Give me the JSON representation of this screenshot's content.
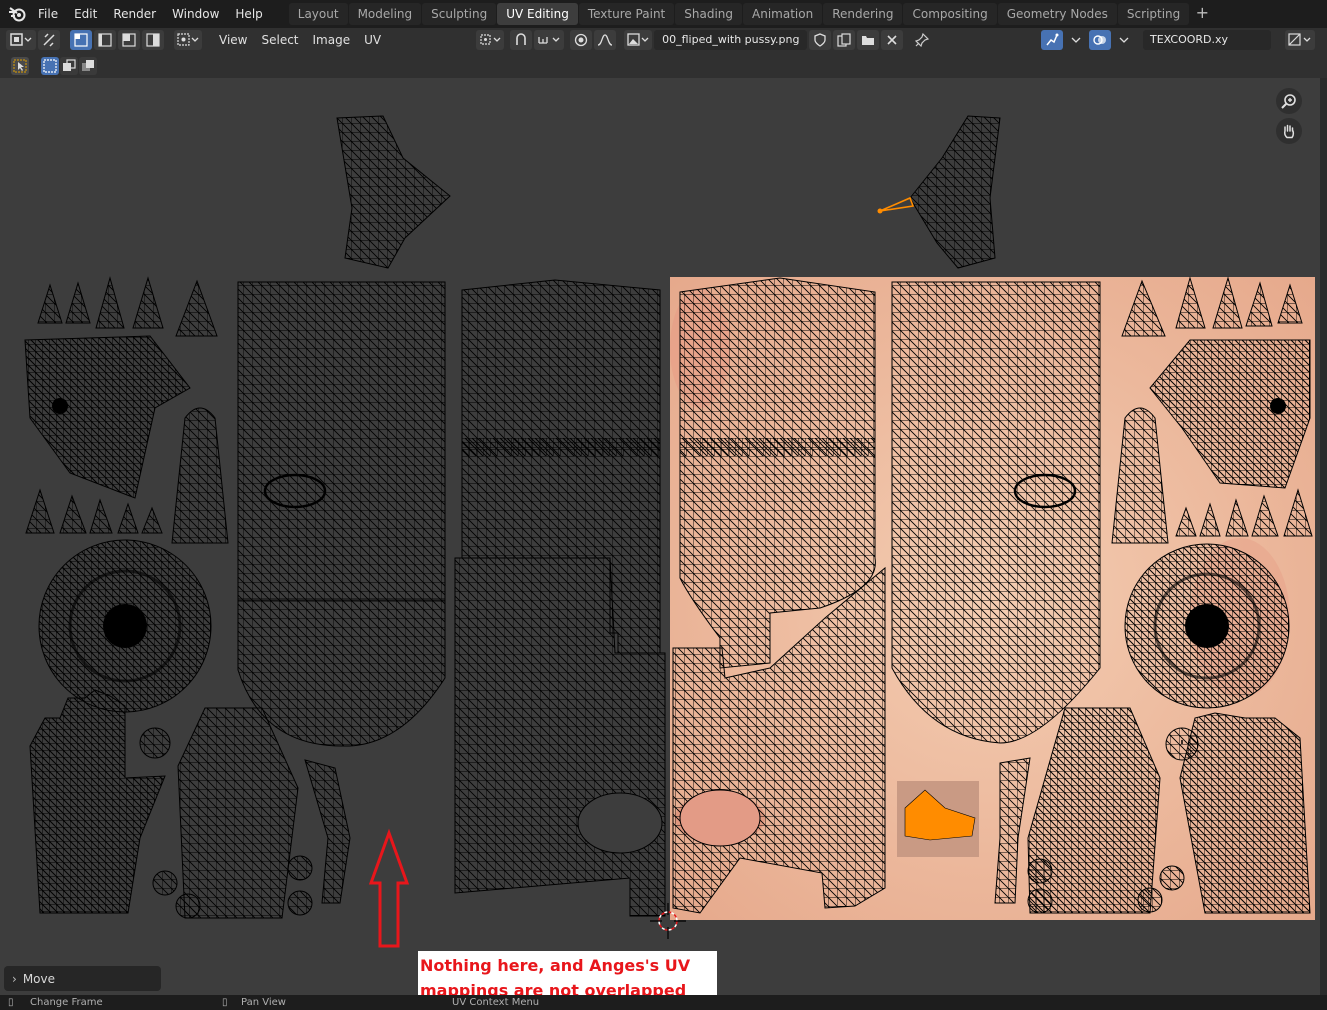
{
  "topbar": {
    "menus": [
      "File",
      "Edit",
      "Render",
      "Window",
      "Help"
    ],
    "workspaces": [
      "Layout",
      "Modeling",
      "Sculpting",
      "UV Editing",
      "Texture Paint",
      "Shading",
      "Animation",
      "Rendering",
      "Compositing",
      "Geometry Nodes",
      "Scripting"
    ],
    "active_workspace": "UV Editing",
    "add_tab": "+"
  },
  "header": {
    "menus": [
      "View",
      "Select",
      "Image",
      "UV"
    ],
    "image_name": "00_fliped_with pussy.png",
    "uv_map": "TEXCOORD.xy"
  },
  "operator_panel": {
    "title": "Move"
  },
  "annotation": {
    "line1": "Nothing here, and Anges's UV",
    "line2": "mappings are not overlapped"
  },
  "statusbar": {
    "left": "Change Frame",
    "middle": "Pan View",
    "right": "UV Context Menu"
  },
  "colors": {
    "viewport_bg": "#3d3d3d",
    "texture_skin": "#f0c3a6",
    "selected_edge": "#ff8c00",
    "annotation_text": "#e8161b",
    "active_tab": "#3d3d3d",
    "accent_blue": "#4772b3"
  },
  "icons": [
    "blender-logo-icon",
    "editor-type-icon",
    "sync-selection-icon",
    "vertex-select-icon",
    "edge-select-icon",
    "face-select-icon",
    "island-select-icon",
    "sticky-mode-icon",
    "pivot-icon",
    "snap-icon",
    "proportional-icon",
    "falloff-icon",
    "image-browse-icon",
    "fake-user-icon",
    "new-image-icon",
    "open-image-icon",
    "unlink-icon",
    "pin-icon",
    "uv-sync-icon",
    "overlay-icon",
    "display-mode-icon",
    "zoom-icon",
    "hand-icon",
    "cursor-crosshair-icon"
  ]
}
